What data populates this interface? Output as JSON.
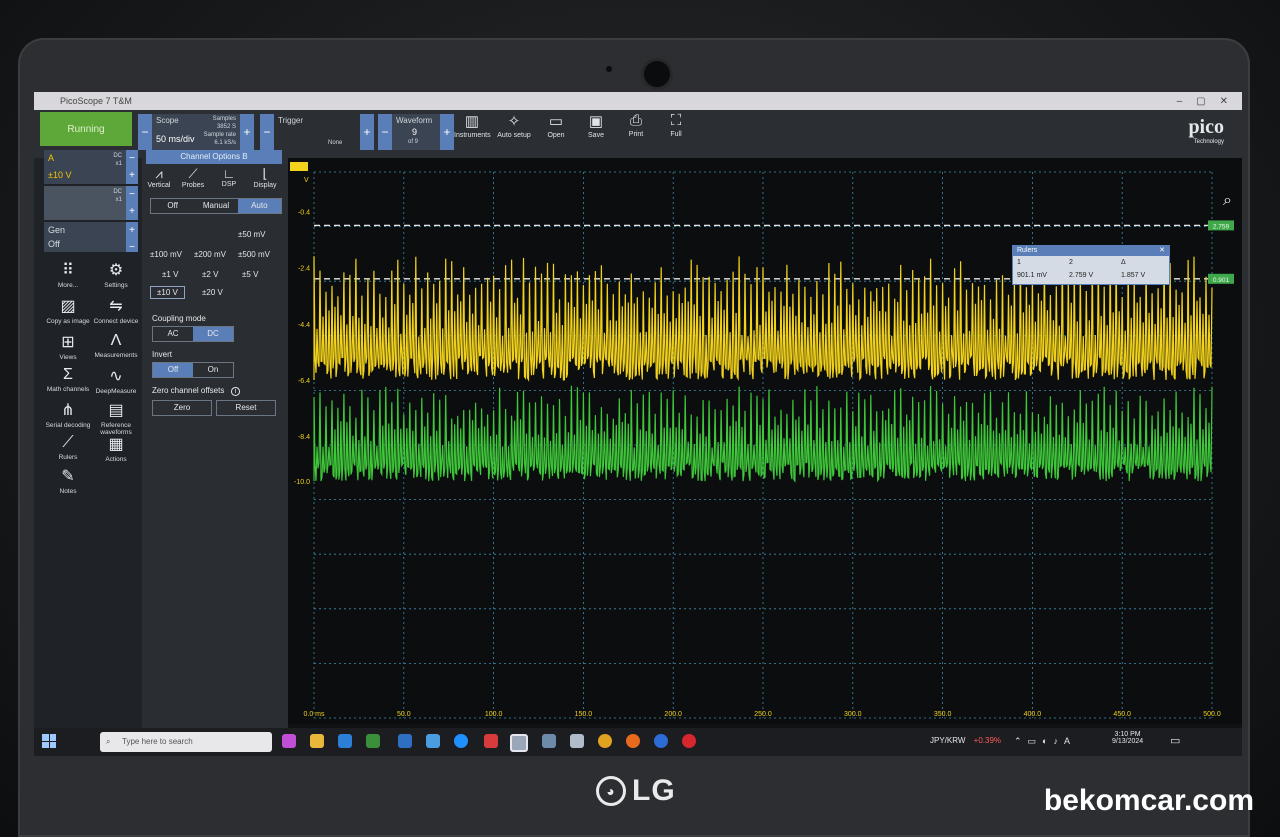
{
  "app": {
    "title": "PicoScope 7 T&M",
    "window_controls": [
      "–",
      "▢",
      "✕"
    ]
  },
  "toolbar": {
    "run_label": "Running",
    "scope_label": "Scope",
    "timebase": "50 ms/div",
    "samples_label": "Samples",
    "samples_value": "3852 S",
    "sample_rate_label": "Sample rate",
    "sample_rate_value": "6.1 kS/s",
    "trigger_label": "Trigger",
    "trigger_value": "None",
    "waveform_label": "Waveform",
    "waveform_index": "9",
    "waveform_of": "of 9",
    "buttons": [
      "Instruments",
      "Auto setup",
      "Open",
      "Save",
      "Print",
      "Full"
    ]
  },
  "channels": [
    {
      "name": "A",
      "range": "±10 V",
      "coupling": "DC",
      "probe": "x1",
      "color": "#f2d21b"
    },
    {
      "name": "B",
      "range": "",
      "coupling": "DC",
      "probe": "x1",
      "color": "#3fc73a"
    }
  ],
  "gen": {
    "label": "Gen",
    "state": "Off"
  },
  "left_tools": [
    "More...",
    "Settings",
    "Copy as image",
    "Connect device",
    "Views",
    "Measurements",
    "Math channels",
    "DeepMeasure",
    "Serial decoding",
    "Reference waveforms",
    "Rulers",
    "Actions",
    "Notes"
  ],
  "channel_panel": {
    "title": "Channel Options",
    "channel_letter": "B",
    "tabs": [
      "Vertical",
      "Probes",
      "DSP",
      "Display"
    ],
    "scaling_modes": [
      "Off",
      "Manual",
      "Auto"
    ],
    "active_scaling": "Auto",
    "ranges": [
      "±50 mV",
      "±100 mV",
      "±200 mV",
      "±500 mV",
      "±1 V",
      "±2 V",
      "±5 V",
      "±10 V",
      "±20 V"
    ],
    "coupling_label": "Coupling mode",
    "coupling_options": [
      "AC",
      "DC"
    ],
    "active_coupling": "DC",
    "invert_label": "Invert",
    "invert_options": [
      "Off",
      "On"
    ],
    "active_invert": "Off",
    "zero_offsets_label": "Zero channel offsets",
    "zero_button": "Zero",
    "reset_button": "Reset"
  },
  "rulers": {
    "title": "Rulers",
    "headers": [
      "1",
      "2",
      "Δ"
    ],
    "values": [
      "901.1 mV",
      "2.759 V",
      "1.857 V"
    ],
    "right_tags": [
      "2.759",
      "0.901"
    ]
  },
  "chart_data": {
    "type": "line",
    "xlabel": "",
    "ylabel": "V",
    "xlim": [
      0,
      500
    ],
    "x_ticks": [
      "0.0 ms",
      "50.0",
      "100.0",
      "150.0",
      "200.0",
      "250.0",
      "300.0",
      "350.0",
      "400.0",
      "450.0",
      "500.0"
    ],
    "y_unit_label": "V",
    "y_ticks": [
      "-0.4",
      "-2.4",
      "-4.4",
      "-6.4",
      "-8.4",
      "-10.0"
    ],
    "series": [
      {
        "color": "#f2d21b",
        "baseline_v": -6.4,
        "peak_v": -2.0,
        "description": "pulse train"
      },
      {
        "color": "#3fc73a",
        "baseline_v": -10.0,
        "peak_v": -6.6,
        "description": "pulse train"
      }
    ],
    "ruler_levels_v": [
      2.759,
      0.901
    ],
    "grid": true
  },
  "taskbar": {
    "search_placeholder": "Type here to search",
    "ticker_symbol": "JPY/KRW",
    "ticker_change": "+0.39%",
    "time": "3:10 PM",
    "date": "9/13/2024"
  },
  "laptop": {
    "brand": "LG"
  },
  "pico_logo": {
    "text": "pico",
    "subtitle": "Technology"
  },
  "watermark": "bekomcar.com"
}
